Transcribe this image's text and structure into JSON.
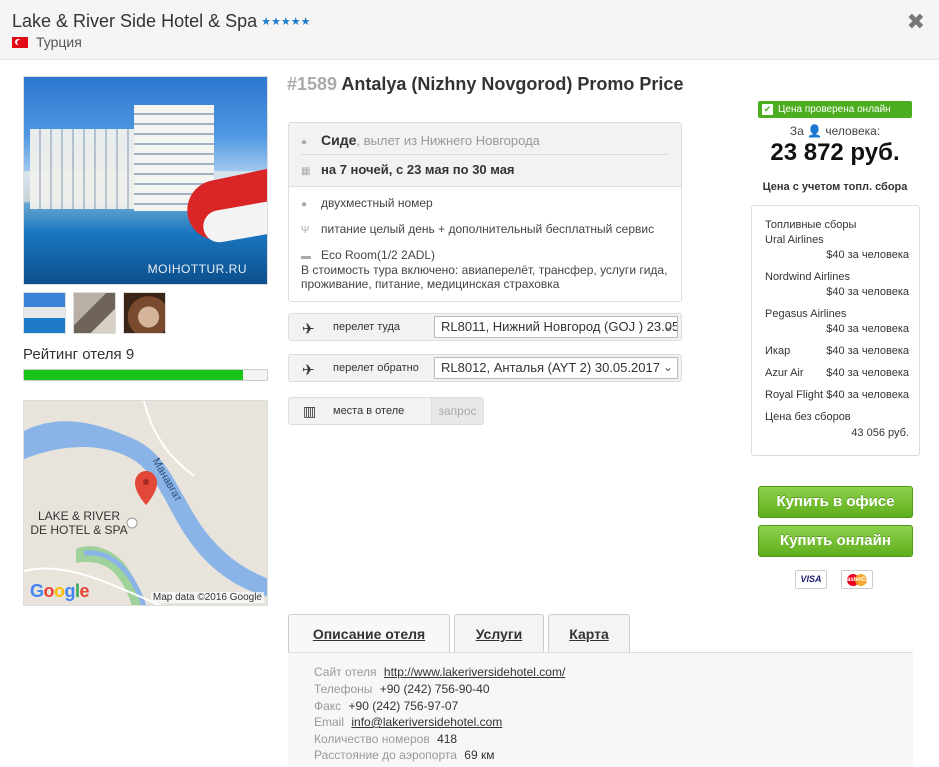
{
  "header": {
    "hotel_name": "Lake & River Side Hotel & Spa",
    "stars": "★★★★★",
    "country": "Турция",
    "close": "✖"
  },
  "gallery": {
    "watermark": "MOIHOTTUR.RU"
  },
  "rating": {
    "label": "Рейтинг отеля 9",
    "value": 9,
    "max": 10
  },
  "map": {
    "hotel_label_line1": "LAKE & RIVER",
    "hotel_label_line2": "DE HOTEL & SPA",
    "river_name": "Манавгат",
    "logo": "Google",
    "attribution": "Map data ©2016 Google"
  },
  "tour": {
    "id": "#1589",
    "title": "Antalya (Nizhny Novgorod) Promo Price",
    "resort": "Сиде",
    "departure": ", вылет из Нижнего Новгорода",
    "dates": "на 7 ночей, с 23 мая по 30 мая",
    "room": "двухместный номер",
    "meal": "питание целый день + дополнительный бесплатный сервис",
    "room_type": "Eco Room(1/2 2ADL)",
    "included_line1": "В стоимость тура включено: авиаперелёт, трансфер, услуги гида,",
    "included_line2": "проживание, питание, медицинская страховка"
  },
  "flights": {
    "outbound_label": "перелет туда",
    "outbound_value": "RL8011, Нижний Новгород (GOJ ) 23.05.2017",
    "return_label": "перелет обратно",
    "return_value": "RL8012, Анталья (AYT 2) 30.05.2017",
    "seats_label": "места в отеле",
    "seats_status": "запрос"
  },
  "pricing": {
    "verified": "Цена проверена онлайн",
    "per_person": "За 👤 человека:",
    "price": "23 872 руб.",
    "note": "Цена с учетом топл. сбора",
    "fees_title": "Топливные сборы",
    "fees": [
      {
        "airline": "Ural Airlines",
        "amount": "$40 за человека"
      },
      {
        "airline": "Nordwind Airlines",
        "amount": "$40 за человека"
      },
      {
        "airline": "Pegasus Airlines",
        "amount": "$40 за человека"
      },
      {
        "airline": "Икар",
        "amount": "$40 за человека"
      },
      {
        "airline": "Azur Air",
        "amount": "$40 за человека"
      },
      {
        "airline": "Royal Flight",
        "amount": "$40 за человека"
      }
    ],
    "without_fees_label": "Цена без сборов",
    "without_fees_value": "43 056 руб."
  },
  "actions": {
    "buy_office": "Купить в офисе",
    "buy_online": "Купить онлайн",
    "visa": "VISA",
    "mastercard": "MasterCard"
  },
  "tabs": {
    "description": "Описание отеля",
    "services": "Услуги",
    "map": "Карта"
  },
  "hotel_info": {
    "site_label": "Сайт отеля",
    "site_value": "http://www.lakeriversidehotel.com/",
    "phone_label": "Телефоны",
    "phone_value": "+90 (242) 756-90-40",
    "fax_label": "Факс",
    "fax_value": "+90 (242) 756-97-07",
    "email_label": "Email",
    "email_value": "info@lakeriversidehotel.com",
    "rooms_label": "Количество номеров",
    "rooms_value": "418",
    "airport_label": "Расстояние до аэропорта",
    "airport_value": "69 км"
  },
  "colors": {
    "green": "#4cae1e",
    "rating": "#19c419",
    "star": "#1f7acb"
  }
}
